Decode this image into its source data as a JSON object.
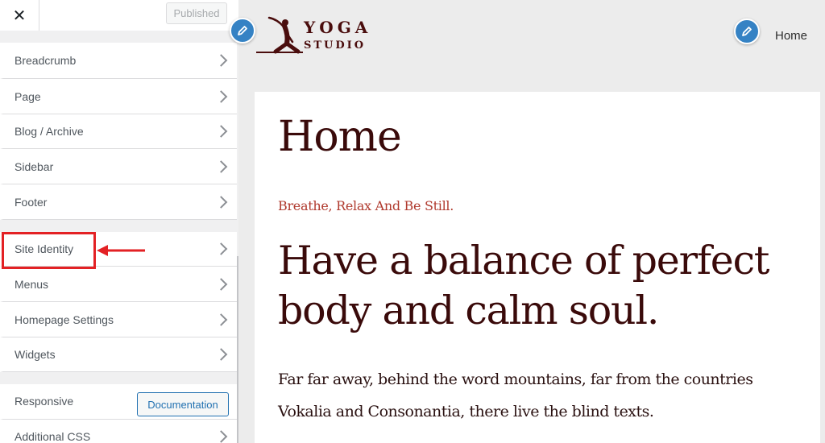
{
  "sidebar": {
    "close_label": "✕",
    "publish_label": "Published",
    "group1": [
      {
        "label": "Breadcrumb"
      },
      {
        "label": "Page"
      },
      {
        "label": "Blog / Archive"
      },
      {
        "label": "Sidebar"
      },
      {
        "label": "Footer"
      }
    ],
    "group2": [
      {
        "label": "Site Identity"
      },
      {
        "label": "Menus"
      },
      {
        "label": "Homepage Settings"
      },
      {
        "label": "Widgets"
      }
    ],
    "group3": [
      {
        "label": "Responsive",
        "button_label": "Documentation"
      },
      {
        "label": "Additional CSS"
      }
    ]
  },
  "site": {
    "logo_line1": "YOGA",
    "logo_line2": "STUDIO",
    "nav_home": "Home"
  },
  "page": {
    "title": "Home",
    "tagline": "Breathe, Relax And Be Still.",
    "headline": "Have a balance of perfect body and calm soul.",
    "paragraph": "Far far away, behind the word mountains, far from the countries Vokalia and Consonantia, there live the blind texts."
  },
  "colors": {
    "accent": "#2271b1",
    "highlight": "#e32124",
    "brand": "#4a0d0d",
    "tagline": "#b03a2e",
    "edit_button": "#3582c4"
  },
  "icons": {
    "close": "close-icon",
    "chevron": "chevron-right-icon",
    "edit": "pencil-icon",
    "logo": "yoga-pose-logo"
  }
}
